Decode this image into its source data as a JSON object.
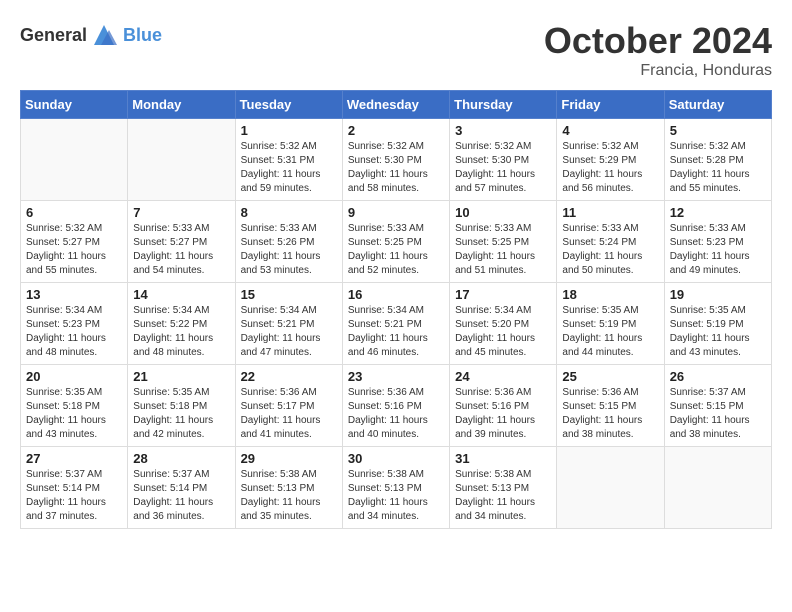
{
  "header": {
    "logo_general": "General",
    "logo_blue": "Blue",
    "month": "October 2024",
    "location": "Francia, Honduras"
  },
  "weekdays": [
    "Sunday",
    "Monday",
    "Tuesday",
    "Wednesday",
    "Thursday",
    "Friday",
    "Saturday"
  ],
  "weeks": [
    [
      {
        "day": "",
        "empty": true
      },
      {
        "day": "",
        "empty": true
      },
      {
        "day": "1",
        "sunrise": "5:32 AM",
        "sunset": "5:31 PM",
        "daylight": "11 hours and 59 minutes."
      },
      {
        "day": "2",
        "sunrise": "5:32 AM",
        "sunset": "5:30 PM",
        "daylight": "11 hours and 58 minutes."
      },
      {
        "day": "3",
        "sunrise": "5:32 AM",
        "sunset": "5:30 PM",
        "daylight": "11 hours and 57 minutes."
      },
      {
        "day": "4",
        "sunrise": "5:32 AM",
        "sunset": "5:29 PM",
        "daylight": "11 hours and 56 minutes."
      },
      {
        "day": "5",
        "sunrise": "5:32 AM",
        "sunset": "5:28 PM",
        "daylight": "11 hours and 55 minutes."
      }
    ],
    [
      {
        "day": "6",
        "sunrise": "5:32 AM",
        "sunset": "5:27 PM",
        "daylight": "11 hours and 55 minutes."
      },
      {
        "day": "7",
        "sunrise": "5:33 AM",
        "sunset": "5:27 PM",
        "daylight": "11 hours and 54 minutes."
      },
      {
        "day": "8",
        "sunrise": "5:33 AM",
        "sunset": "5:26 PM",
        "daylight": "11 hours and 53 minutes."
      },
      {
        "day": "9",
        "sunrise": "5:33 AM",
        "sunset": "5:25 PM",
        "daylight": "11 hours and 52 minutes."
      },
      {
        "day": "10",
        "sunrise": "5:33 AM",
        "sunset": "5:25 PM",
        "daylight": "11 hours and 51 minutes."
      },
      {
        "day": "11",
        "sunrise": "5:33 AM",
        "sunset": "5:24 PM",
        "daylight": "11 hours and 50 minutes."
      },
      {
        "day": "12",
        "sunrise": "5:33 AM",
        "sunset": "5:23 PM",
        "daylight": "11 hours and 49 minutes."
      }
    ],
    [
      {
        "day": "13",
        "sunrise": "5:34 AM",
        "sunset": "5:23 PM",
        "daylight": "11 hours and 48 minutes."
      },
      {
        "day": "14",
        "sunrise": "5:34 AM",
        "sunset": "5:22 PM",
        "daylight": "11 hours and 48 minutes."
      },
      {
        "day": "15",
        "sunrise": "5:34 AM",
        "sunset": "5:21 PM",
        "daylight": "11 hours and 47 minutes."
      },
      {
        "day": "16",
        "sunrise": "5:34 AM",
        "sunset": "5:21 PM",
        "daylight": "11 hours and 46 minutes."
      },
      {
        "day": "17",
        "sunrise": "5:34 AM",
        "sunset": "5:20 PM",
        "daylight": "11 hours and 45 minutes."
      },
      {
        "day": "18",
        "sunrise": "5:35 AM",
        "sunset": "5:19 PM",
        "daylight": "11 hours and 44 minutes."
      },
      {
        "day": "19",
        "sunrise": "5:35 AM",
        "sunset": "5:19 PM",
        "daylight": "11 hours and 43 minutes."
      }
    ],
    [
      {
        "day": "20",
        "sunrise": "5:35 AM",
        "sunset": "5:18 PM",
        "daylight": "11 hours and 43 minutes."
      },
      {
        "day": "21",
        "sunrise": "5:35 AM",
        "sunset": "5:18 PM",
        "daylight": "11 hours and 42 minutes."
      },
      {
        "day": "22",
        "sunrise": "5:36 AM",
        "sunset": "5:17 PM",
        "daylight": "11 hours and 41 minutes."
      },
      {
        "day": "23",
        "sunrise": "5:36 AM",
        "sunset": "5:16 PM",
        "daylight": "11 hours and 40 minutes."
      },
      {
        "day": "24",
        "sunrise": "5:36 AM",
        "sunset": "5:16 PM",
        "daylight": "11 hours and 39 minutes."
      },
      {
        "day": "25",
        "sunrise": "5:36 AM",
        "sunset": "5:15 PM",
        "daylight": "11 hours and 38 minutes."
      },
      {
        "day": "26",
        "sunrise": "5:37 AM",
        "sunset": "5:15 PM",
        "daylight": "11 hours and 38 minutes."
      }
    ],
    [
      {
        "day": "27",
        "sunrise": "5:37 AM",
        "sunset": "5:14 PM",
        "daylight": "11 hours and 37 minutes."
      },
      {
        "day": "28",
        "sunrise": "5:37 AM",
        "sunset": "5:14 PM",
        "daylight": "11 hours and 36 minutes."
      },
      {
        "day": "29",
        "sunrise": "5:38 AM",
        "sunset": "5:13 PM",
        "daylight": "11 hours and 35 minutes."
      },
      {
        "day": "30",
        "sunrise": "5:38 AM",
        "sunset": "5:13 PM",
        "daylight": "11 hours and 34 minutes."
      },
      {
        "day": "31",
        "sunrise": "5:38 AM",
        "sunset": "5:13 PM",
        "daylight": "11 hours and 34 minutes."
      },
      {
        "day": "",
        "empty": true
      },
      {
        "day": "",
        "empty": true
      }
    ]
  ]
}
